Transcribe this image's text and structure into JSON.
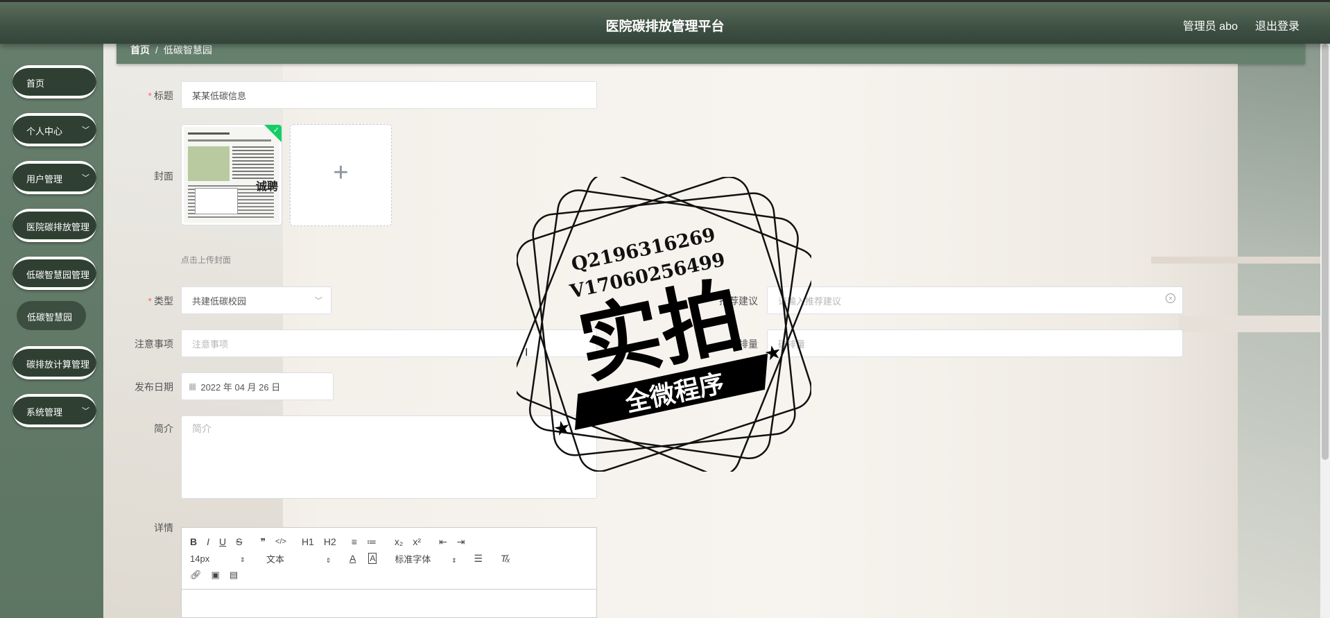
{
  "app": {
    "title": "医院碳排放管理平台",
    "admin_label": "管理员 abo",
    "logout": "退出登录"
  },
  "sidebar": {
    "items": [
      {
        "label": "首页",
        "has_children": false
      },
      {
        "label": "个人中心",
        "has_children": true
      },
      {
        "label": "用户管理",
        "has_children": true
      },
      {
        "label": "医院碳排放管理",
        "has_children": false
      },
      {
        "label": "低碳智慧园管理",
        "has_children": false
      },
      {
        "label": "碳排放计算管理",
        "has_children": false
      },
      {
        "label": "系统管理",
        "has_children": true
      }
    ],
    "sub_item": "低碳智慧园"
  },
  "breadcrumb": {
    "home": "首页",
    "sep": "/",
    "current": "低碳智慧园"
  },
  "form": {
    "title_label": "标题",
    "title_value": "某某低碳信息",
    "cover_label": "封面",
    "cover_hint": "点击上传封面",
    "type_label": "类型",
    "type_value": "共建低碳校园",
    "recommend_label": "推荐建议",
    "recommend_placeholder": "请输入推荐建议",
    "notes_label": "注意事项",
    "notes_placeholder": "注意事项",
    "carbon_label": "碳排量",
    "carbon_placeholder": "碳排量",
    "date_label": "发布日期",
    "date_value": "2022 年 04 月 26 日",
    "intro_label": "简介",
    "intro_placeholder": "简介",
    "detail_label": "详情"
  },
  "editor": {
    "font_size": "14px",
    "text_style": "文本",
    "font_family": "标准字体",
    "row1": [
      "B",
      "I",
      "U",
      "S",
      "❞",
      "</>",
      "H1",
      "H2",
      "≡",
      "≔",
      "x₂",
      "x²",
      "⇤",
      "⇥"
    ]
  },
  "watermark": {
    "qq": "Q2196316269",
    "vx": "V17060256499",
    "big": "实拍",
    "banner": "全微程序"
  },
  "icons": {
    "plus": "plus-icon",
    "check": "check-icon",
    "calendar": "calendar-icon",
    "chevron": "chevron-down-icon"
  }
}
